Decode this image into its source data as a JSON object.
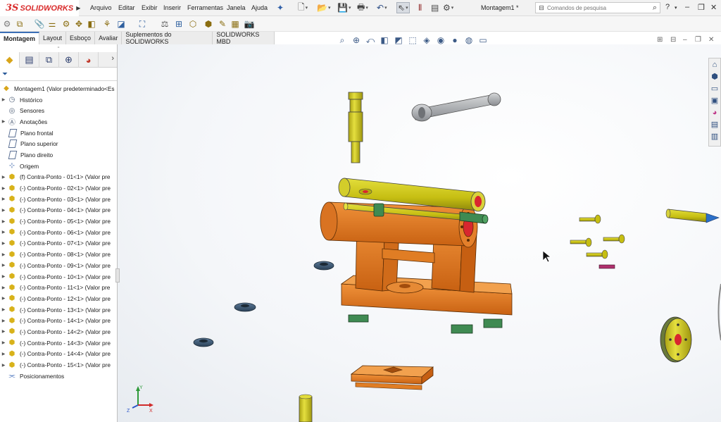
{
  "app": {
    "brand": "SOLIDWORKS",
    "logo_mark": "3S"
  },
  "menu": [
    "Arquivo",
    "Editar",
    "Exibir",
    "Inserir",
    "Ferramentas",
    "Janela",
    "Ajuda"
  ],
  "document_title": "Montagem1 *",
  "search": {
    "placeholder": "Comandos de pesquisa"
  },
  "tabs": [
    "Montagem",
    "Layout",
    "Esboço",
    "Avaliar",
    "Suplementos do SOLIDWORKS",
    "SOLIDWORKS MBD"
  ],
  "active_tab": "Montagem",
  "feature_tree": {
    "root": "Montagem1  (Valor predeterminado<Es",
    "items": [
      {
        "label": "Histórico",
        "icon": "history-folder-icon",
        "expandable": true
      },
      {
        "label": "Sensores",
        "icon": "sensor-folder-icon",
        "expandable": false
      },
      {
        "label": "Anotações",
        "icon": "annotations-folder-icon",
        "expandable": true
      },
      {
        "label": "Plano frontal",
        "icon": "plane-icon",
        "expandable": false
      },
      {
        "label": "Plano superior",
        "icon": "plane-icon",
        "expandable": false
      },
      {
        "label": "Plano direito",
        "icon": "plane-icon",
        "expandable": false
      },
      {
        "label": "Origem",
        "icon": "origin-icon",
        "expandable": false
      },
      {
        "label": "(f) Contra-Ponto - 01<1> (Valor pre",
        "icon": "part-icon",
        "expandable": true
      },
      {
        "label": "(-) Contra-Ponto - 02<1> (Valor pre",
        "icon": "part-icon",
        "expandable": true
      },
      {
        "label": "(-) Contra-Ponto - 03<1> (Valor pre",
        "icon": "part-icon",
        "expandable": true
      },
      {
        "label": "(-) Contra-Ponto - 04<1> (Valor pre",
        "icon": "part-icon",
        "expandable": true
      },
      {
        "label": "(-) Contra-Ponto - 05<1> (Valor pre",
        "icon": "part-icon",
        "expandable": true
      },
      {
        "label": "(-) Contra-Ponto - 06<1> (Valor pre",
        "icon": "part-icon",
        "expandable": true
      },
      {
        "label": "(-) Contra-Ponto - 07<1> (Valor pre",
        "icon": "part-icon",
        "expandable": true
      },
      {
        "label": "(-) Contra-Ponto - 08<1> (Valor pre",
        "icon": "part-icon",
        "expandable": true
      },
      {
        "label": "(-) Contra-Ponto - 09<1> (Valor pre",
        "icon": "part-icon",
        "expandable": true
      },
      {
        "label": "(-) Contra-Ponto - 10<1> (Valor pre",
        "icon": "part-icon",
        "expandable": true
      },
      {
        "label": "(-) Contra-Ponto - 11<1> (Valor pre",
        "icon": "part-icon",
        "expandable": true
      },
      {
        "label": "(-) Contra-Ponto - 12<1> (Valor pre",
        "icon": "part-icon",
        "expandable": true
      },
      {
        "label": "(-) Contra-Ponto - 13<1> (Valor pre",
        "icon": "part-icon",
        "expandable": true
      },
      {
        "label": "(-) Contra-Ponto - 14<1> (Valor pre",
        "icon": "part-icon",
        "expandable": true
      },
      {
        "label": "(-) Contra-Ponto - 14<2> (Valor pre",
        "icon": "part-icon",
        "expandable": true
      },
      {
        "label": "(-) Contra-Ponto - 14<3> (Valor pre",
        "icon": "part-icon",
        "expandable": true
      },
      {
        "label": "(-) Contra-Ponto - 14<4> (Valor pre",
        "icon": "part-icon",
        "expandable": true
      },
      {
        "label": "(-) Contra-Ponto - 15<1> (Valor pre",
        "icon": "part-icon",
        "expandable": true
      },
      {
        "label": "Posicionamentos",
        "icon": "mates-icon",
        "expandable": false
      }
    ]
  },
  "triad": {
    "x": "X",
    "y": "Y",
    "z": "Z"
  },
  "colors": {
    "brand_red": "#d92b2b",
    "part_orange": "#e0781c",
    "part_yellow": "#c8c21a",
    "part_green": "#3f8a52",
    "nut_blue": "#35506e",
    "handle_grey": "#a8aaad",
    "face_red": "#d8262f",
    "accent_blue": "#3b6fb6"
  }
}
